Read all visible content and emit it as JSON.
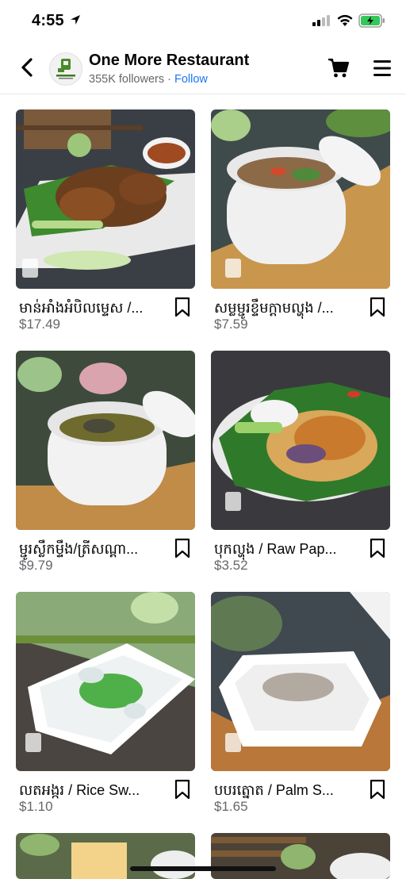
{
  "status_bar": {
    "time": "4:55"
  },
  "header": {
    "page_name": "One More Restaurant",
    "followers": "355K followers",
    "separator": " · ",
    "follow_label": "Follow"
  },
  "products": [
    {
      "title": "មាន់អាំងអំបិលម្ទេស /...",
      "price": "$17.49"
    },
    {
      "title": "សម្លម្ជូរខ្ទឹមក្ដាមល្ហុង /...",
      "price": "$7.59"
    },
    {
      "title": "ម្ជូរស្លឹកម្ទឹង/ត្រីសណ្ដា...",
      "price": "$9.79"
    },
    {
      "title": "បុកល្ហុង / Raw Pap...",
      "price": "$3.52"
    },
    {
      "title": "លតអង្ករ / Rice Sw...",
      "price": "$1.10"
    },
    {
      "title": "បបរត្នោត / Palm S...",
      "price": "$1.65"
    }
  ],
  "colors": {
    "accent": "#1877f2",
    "text": "#050505",
    "secondary": "#65676b",
    "battery": "#34c759"
  }
}
